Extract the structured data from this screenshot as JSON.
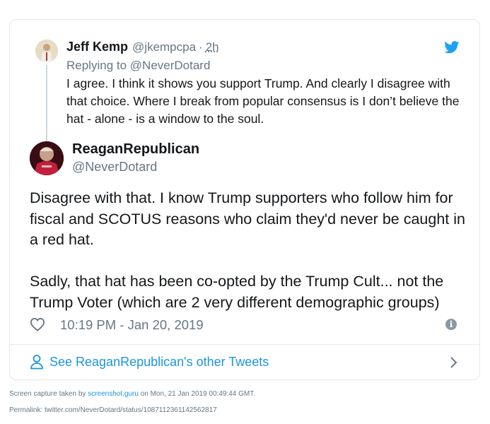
{
  "parent_tweet": {
    "name": "Jeff Kemp",
    "handle": "@jkempcpa",
    "separator": "·",
    "time": "2h",
    "replying_prefix": "Replying to",
    "replying_to": "@NeverDotard",
    "text": "I agree.  I think it shows you support Trump.  And clearly I disagree with that choice.  Where I break from popular consensus is I don’t believe the hat - alone - is a window to the soul."
  },
  "main_tweet": {
    "name": "ReaganRepublican",
    "handle": "@NeverDotard",
    "text": "Disagree with that. I know Trump supporters who follow him for fiscal and SCOTUS reasons who claim they'd never be caught in a red hat.\n\nSadly, that hat has been co-opted by the Trump Cult... not the Trump Voter (which are 2 very different demographic groups)",
    "timestamp": "10:19 PM - Jan 20, 2019",
    "info_icon": "i"
  },
  "see_more": {
    "label": "See ReaganRepublican's other Tweets"
  },
  "footer": {
    "capture_prefix": "Screen capture taken by",
    "capture_site": "screenshot.guru",
    "capture_suffix": "on Mon, 21 Jan 2019 00:49:44 GMT.",
    "permalink": "Permalink: twitter.com/NeverDotard/status/1087112361142562817"
  },
  "colors": {
    "accent": "#1b95e0",
    "twitter_blue": "#1da1f2",
    "muted": "#657786",
    "border": "#e1e8ed"
  },
  "icons": [
    "avatar",
    "twitter-bird-icon",
    "heart-icon",
    "info-icon",
    "person-icon",
    "chevron-right-icon"
  ]
}
